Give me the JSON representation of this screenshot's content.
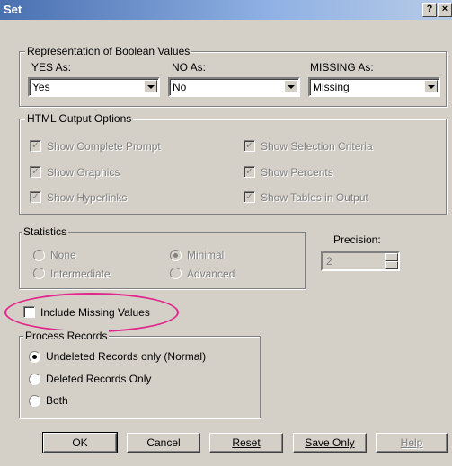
{
  "window": {
    "title": "Set",
    "help_btn": "?",
    "close_btn": "×"
  },
  "boolean_group": {
    "legend": "Representation of Boolean Values",
    "yes_label": "YES As:",
    "yes_value": "Yes",
    "no_label": "NO As:",
    "no_value": "No",
    "missing_label": "MISSING As:",
    "missing_value": "Missing"
  },
  "html_group": {
    "legend": "HTML Output Options",
    "options": [
      "Show Complete Prompt",
      "Show Selection Criteria",
      "Show Graphics",
      "Show Percents",
      "Show Hyperlinks",
      "Show Tables in Output"
    ],
    "check_mark": "✓"
  },
  "statistics_group": {
    "legend": "Statistics",
    "none": "None",
    "minimal": "Minimal",
    "intermediate": "Intermediate",
    "advanced": "Advanced"
  },
  "precision": {
    "label": "Precision:",
    "value": "2"
  },
  "include_missing": {
    "label": "Include Missing Values"
  },
  "process_group": {
    "legend": "Process Records",
    "undeleted": "Undeleted Records only (Normal)",
    "deleted": "Deleted Records Only",
    "both": "Both"
  },
  "buttons": {
    "ok": "OK",
    "cancel": "Cancel",
    "reset": "Reset",
    "save_only": "Save Only",
    "help": "Help"
  },
  "colors": {
    "highlight": "#e0278b",
    "titlebar": "#4a70b0"
  }
}
